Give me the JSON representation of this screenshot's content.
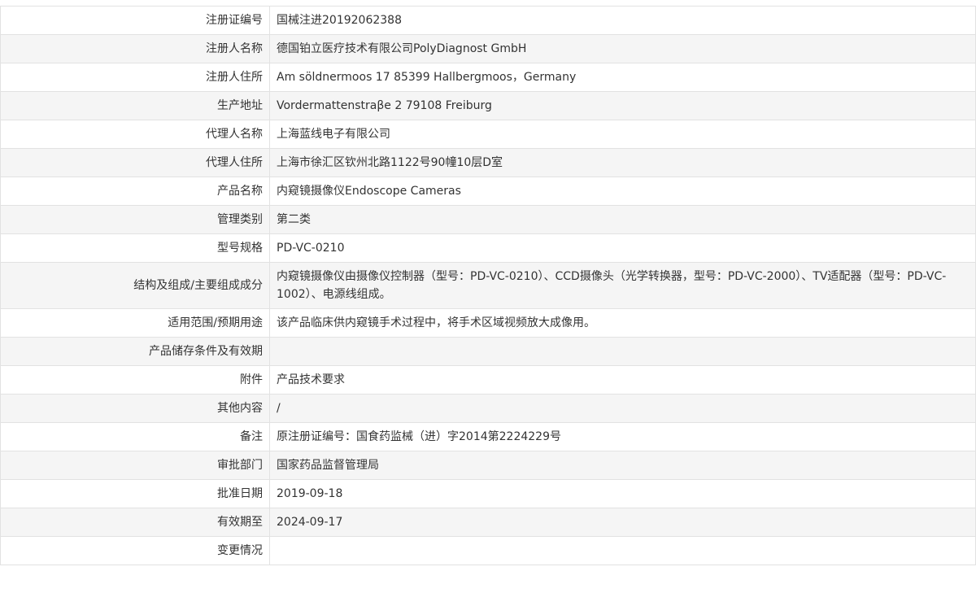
{
  "rows": [
    {
      "label": "注册证编号",
      "value": "国械注进20192062388"
    },
    {
      "label": "注册人名称",
      "value": "德国铂立医疗技术有限公司PolyDiagnost GmbH"
    },
    {
      "label": "注册人住所",
      "value": "Am söldnermoos 17 85399 Hallbergmoos，Germany"
    },
    {
      "label": "生产地址",
      "value": "Vordermattenstraβe 2 79108 Freiburg"
    },
    {
      "label": "代理人名称",
      "value": "上海蓝线电子有限公司"
    },
    {
      "label": "代理人住所",
      "value": "上海市徐汇区钦州北路1122号90幢10层D室"
    },
    {
      "label": "产品名称",
      "value": "内窥镜摄像仪Endoscope Cameras"
    },
    {
      "label": "管理类别",
      "value": "第二类"
    },
    {
      "label": "型号规格",
      "value": "PD-VC-0210"
    },
    {
      "label": "结构及组成/主要组成成分",
      "value": "内窥镜摄像仪由摄像仪控制器（型号：PD-VC-0210）、CCD摄像头（光学转换器，型号：PD-VC-2000）、TV适配器（型号：PD-VC-1002）、电源线组成。"
    },
    {
      "label": "适用范围/预期用途",
      "value": "该产品临床供内窥镜手术过程中，将手术区域视频放大成像用。"
    },
    {
      "label": "产品储存条件及有效期",
      "value": ""
    },
    {
      "label": "附件",
      "value": "产品技术要求"
    },
    {
      "label": "其他内容",
      "value": "/"
    },
    {
      "label": "备注",
      "value": "原注册证编号：国食药监械（进）字2014第2224229号"
    },
    {
      "label": "审批部门",
      "value": "国家药品监督管理局"
    },
    {
      "label": "批准日期",
      "value": "2019-09-18"
    },
    {
      "label": "有效期至",
      "value": "2024-09-17"
    },
    {
      "label": "变更情况",
      "value": ""
    }
  ]
}
